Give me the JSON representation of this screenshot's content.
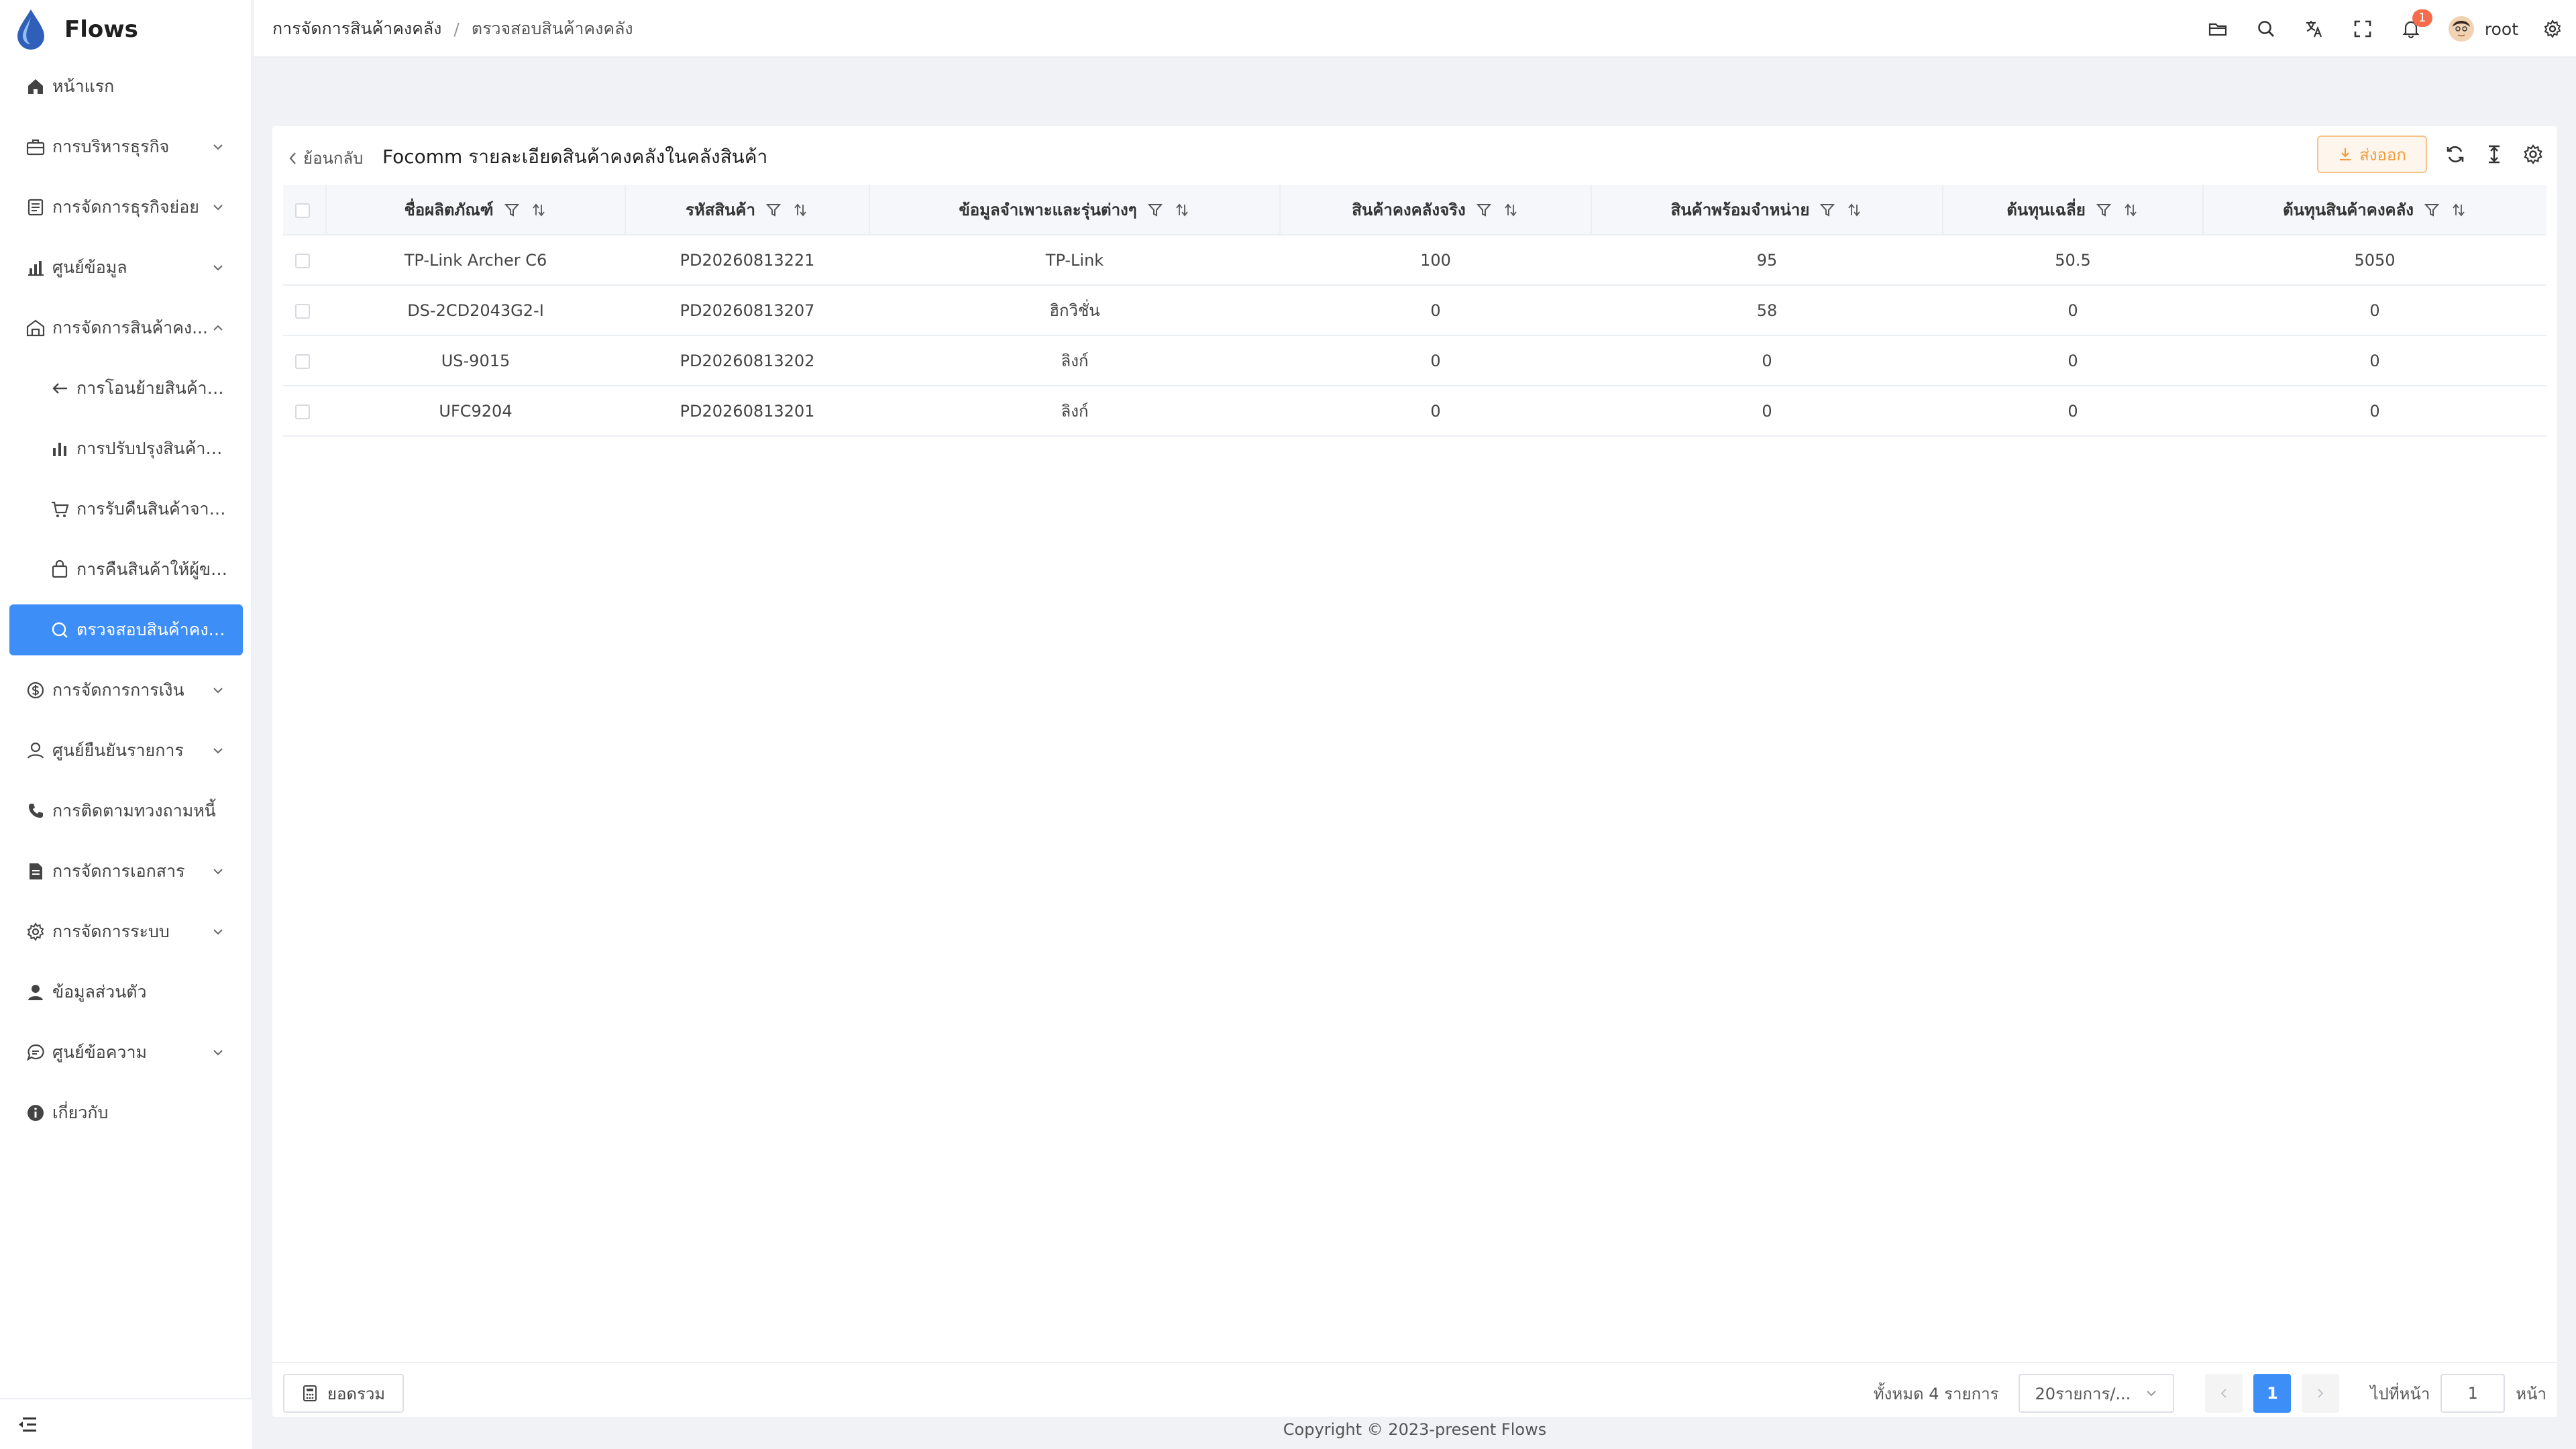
{
  "app": {
    "name": "Flows"
  },
  "sidebar": {
    "items": [
      {
        "label": "หน้าแรก",
        "icon": "home-icon",
        "expandable": false
      },
      {
        "label": "การบริหารธุรกิจ",
        "icon": "briefcase-icon",
        "expandable": true
      },
      {
        "label": "การจัดการธุรกิจย่อย",
        "icon": "document-icon",
        "expandable": true
      },
      {
        "label": "ศูนย์ข้อมูล",
        "icon": "bar-chart-icon",
        "expandable": true
      },
      {
        "label": "การจัดการสินค้าคง...",
        "icon": "warehouse-icon",
        "expandable": true,
        "expanded": true
      },
      {
        "label": "การโอนย้ายสินค้าค...",
        "icon": "arrow-left-icon",
        "sub": true
      },
      {
        "label": "การปรับปรุงสินค้าค...",
        "icon": "chart-bars-icon",
        "sub": true
      },
      {
        "label": "การรับคืนสินค้าจาก...",
        "icon": "cart-icon",
        "sub": true
      },
      {
        "label": "การคืนสินค้าให้ผู้ขาย",
        "icon": "bag-icon",
        "sub": true
      },
      {
        "label": "ตรวจสอบสินค้าคงคลัง",
        "icon": "search-circle-icon",
        "sub": true,
        "active": true
      },
      {
        "label": "การจัดการการเงิน",
        "icon": "dollar-icon",
        "expandable": true
      },
      {
        "label": "ศูนย์ยืนยันรายการ",
        "icon": "user-check-icon",
        "expandable": true
      },
      {
        "label": "การติดตามทวงถามหนี้",
        "icon": "phone-icon",
        "expandable": false
      },
      {
        "label": "การจัดการเอกสาร",
        "icon": "file-icon",
        "expandable": true
      },
      {
        "label": "การจัดการระบบ",
        "icon": "settings-icon",
        "expandable": true
      },
      {
        "label": "ข้อมูลส่วนตัว",
        "icon": "person-icon",
        "expandable": false
      },
      {
        "label": "ศูนย์ข้อความ",
        "icon": "chat-icon",
        "expandable": true
      },
      {
        "label": "เกี่ยวกับ",
        "icon": "info-icon",
        "expandable": false
      }
    ]
  },
  "header": {
    "breadcrumb": [
      "การจัดการสินค้าคงคลัง",
      "ตรวจสอบสินค้าคงคลัง"
    ],
    "notification_count": "1",
    "username": "root"
  },
  "page": {
    "back_label": "ย้อนกลับ",
    "title": "Focomm รายละเอียดสินค้าคงคลังในคลังสินค้า",
    "export_label": "ส่งออก"
  },
  "table": {
    "columns": [
      "ชื่อผลิตภัณฑ์",
      "รหัสสินค้า",
      "ข้อมูลจำเพาะและรุ่นต่างๆ",
      "สินค้าคงคลังจริง",
      "สินค้าพร้อมจำหน่าย",
      "ต้นทุนเฉลี่ย",
      "ต้นทุนสินค้าคงคลัง"
    ],
    "rows": [
      [
        "TP-Link Archer C6",
        "PD20260813221",
        "TP-Link",
        "100",
        "95",
        "50.5",
        "5050"
      ],
      [
        "DS-2CD2043G2-I",
        "PD20260813207",
        "ฮิกวิชั่น",
        "0",
        "58",
        "0",
        "0"
      ],
      [
        "US-9015",
        "PD20260813202",
        "ลิงก์",
        "0",
        "0",
        "0",
        "0"
      ],
      [
        "UFC9204",
        "PD20260813201",
        "ลิงก์",
        "0",
        "0",
        "0",
        "0"
      ]
    ]
  },
  "footer": {
    "summary_label": "ยอดรวม",
    "total_text": "ทั้งหมด 4 รายการ",
    "page_size": "20รายการ/...",
    "current_page": "1",
    "goto_label": "ไปที่หน้า",
    "goto_value": "1",
    "goto_suffix": "หน้า"
  },
  "copyright": "Copyright © 2023-present Flows",
  "colors": {
    "primary": "#3e8ef7",
    "export": "#f29b38",
    "badge": "#f56c4c"
  }
}
